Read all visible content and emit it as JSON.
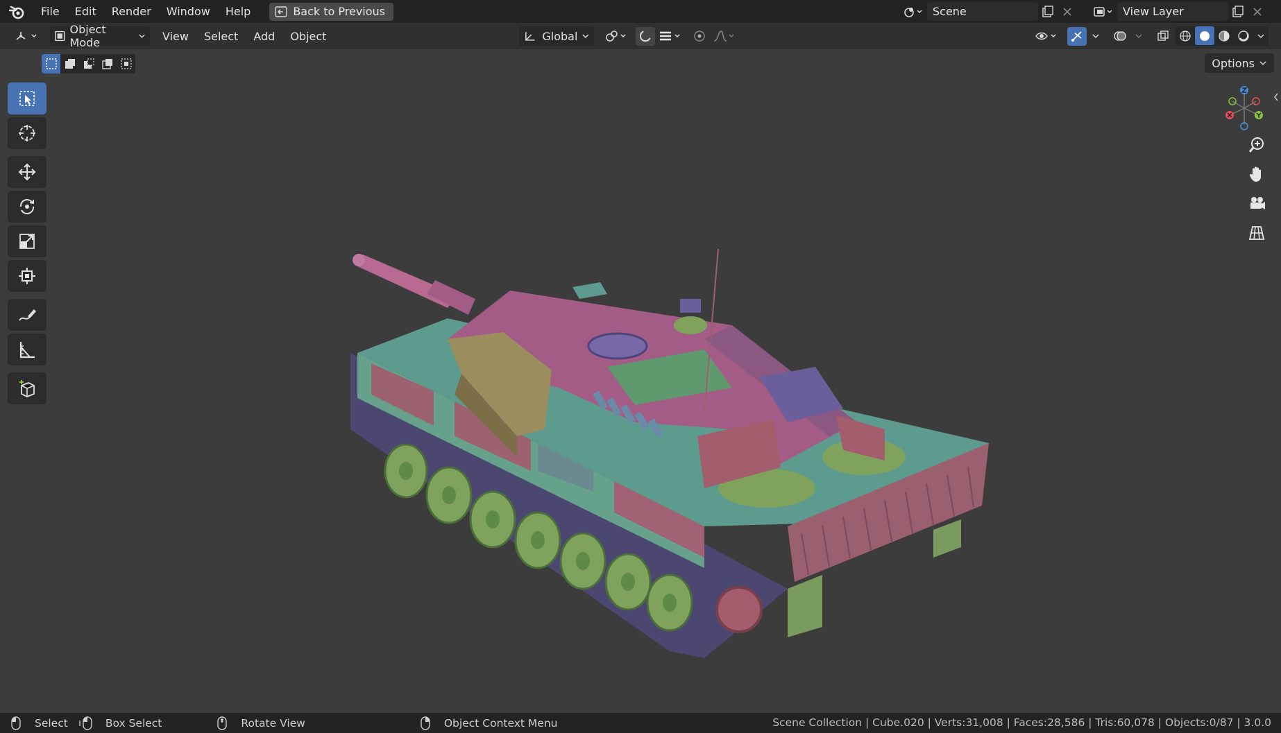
{
  "top_menu": {
    "items": [
      "File",
      "Edit",
      "Render",
      "Window",
      "Help"
    ],
    "back_button": "Back to Previous"
  },
  "scene": {
    "label": "Scene"
  },
  "view_layer": {
    "label": "View Layer"
  },
  "viewport_header": {
    "mode": "Object Mode",
    "menus": [
      "View",
      "Select",
      "Add",
      "Object"
    ],
    "orientation": "Global",
    "options_label": "Options"
  },
  "toolbar": {
    "tools": [
      "select-box",
      "cursor",
      "move",
      "rotate",
      "scale",
      "transform",
      "annotate",
      "measure",
      "add-cube"
    ],
    "active_tool": "select-box"
  },
  "status_bar": {
    "select": "Select",
    "box_select": "Box Select",
    "rotate_view": "Rotate View",
    "context_menu": "Object Context Menu",
    "stats": "Scene Collection | Cube.020 | Verts:31,008 | Faces:28,586 | Tris:60,078 | Objects:0/87 | 3.0.0"
  },
  "colors": {
    "accent": "#4772b3",
    "topbar": "#232323",
    "header": "#303030",
    "viewport": "#3c3c3c",
    "axis_x": "#e34d5c",
    "axis_y": "#8bc43f",
    "axis_z": "#4a8fe0"
  },
  "viewport_object": {
    "icon": "tank-model"
  }
}
